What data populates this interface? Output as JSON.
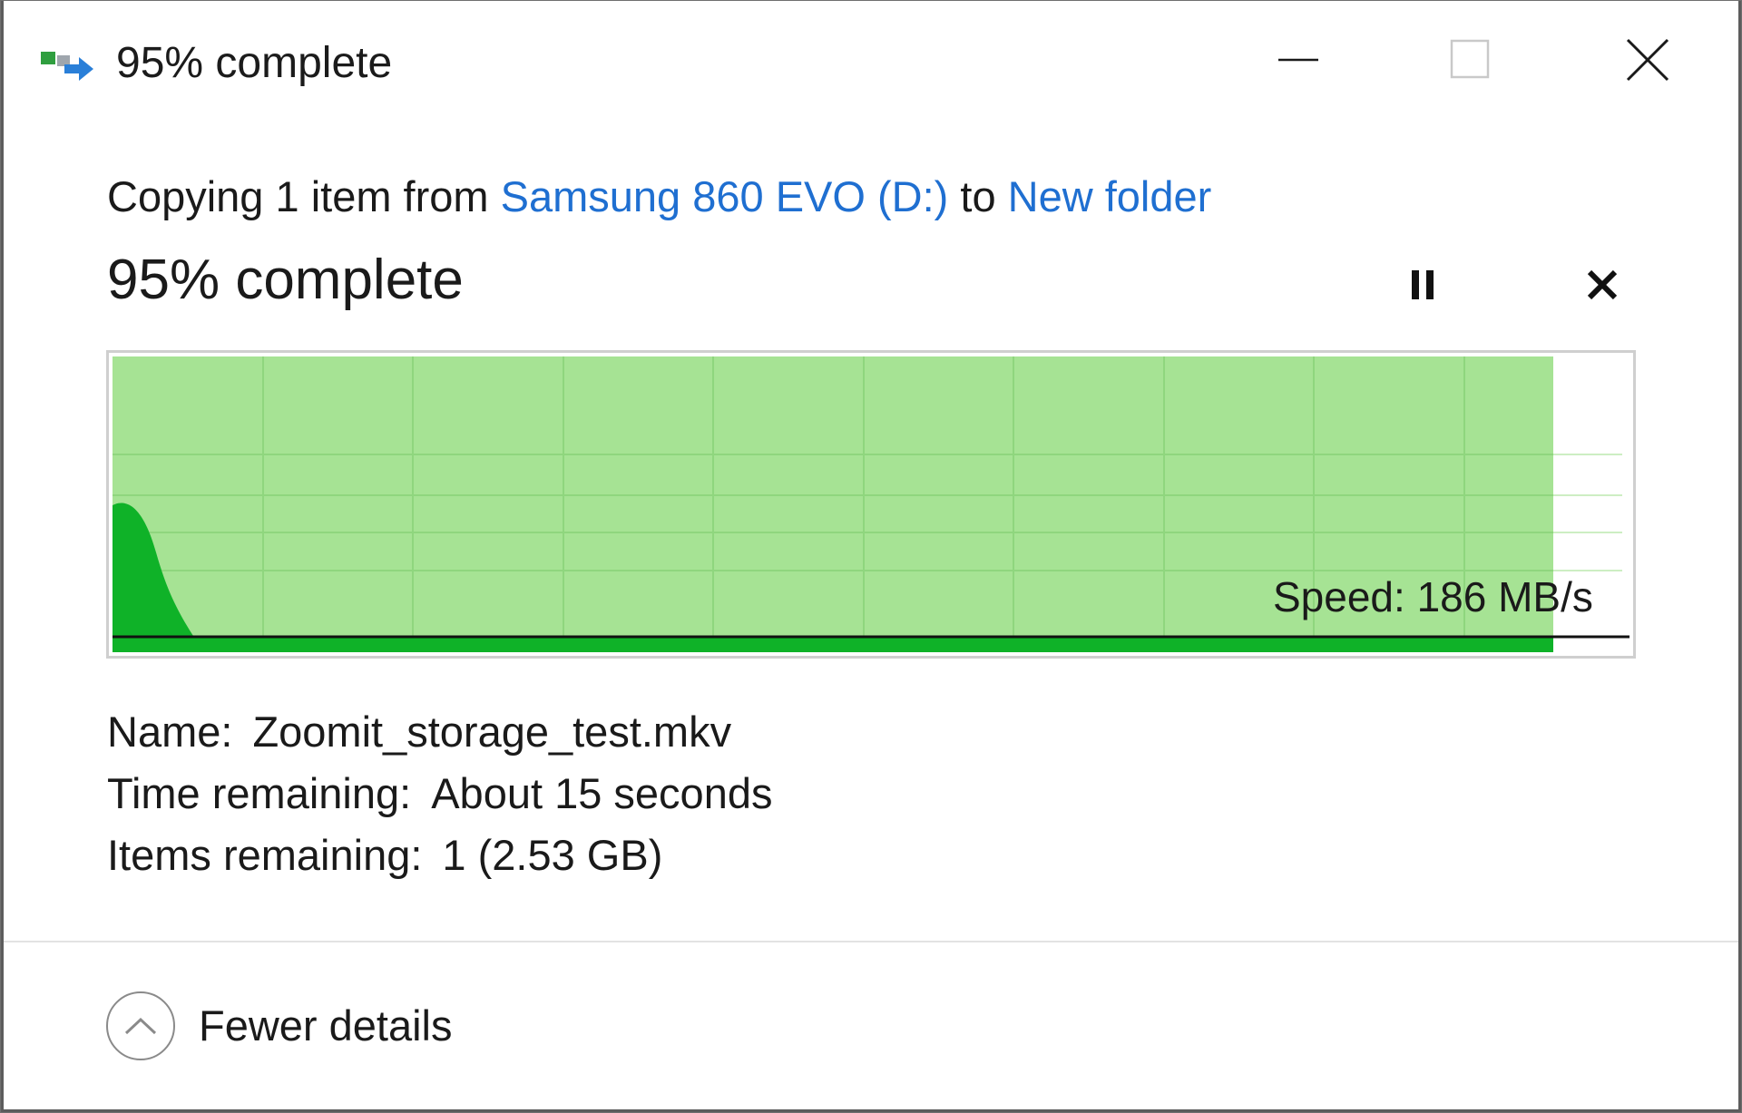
{
  "window": {
    "title": "95% complete"
  },
  "main": {
    "copy_prefix": "Copying 1 item from ",
    "source": "Samsung 860 EVO (D:)",
    "to_word": " to ",
    "destination": "New folder",
    "progress_text": "95% complete",
    "progress_fraction": 0.95,
    "speed_text": "Speed: 186 MB/s"
  },
  "details": {
    "name_label": "Name:",
    "name_value": "Zoomit_storage_test.mkv",
    "time_label": "Time remaining:",
    "time_value": "About 15 seconds",
    "items_label": "Items remaining:",
    "items_value": "1 (2.53 GB)"
  },
  "footer": {
    "toggle_label": "Fewer details"
  },
  "colors": {
    "progress_fill": "#a6e394",
    "speed_fill": "#0fb228",
    "grid_line": "#8fd67e",
    "link": "#1f6fd1"
  },
  "icons": {
    "app": "copy-transfer-icon",
    "minimize": "minimize-icon",
    "maximize": "maximize-icon",
    "close": "close-icon",
    "pause": "pause-icon",
    "cancel": "cancel-icon",
    "collapse": "chevron-up-icon"
  }
}
